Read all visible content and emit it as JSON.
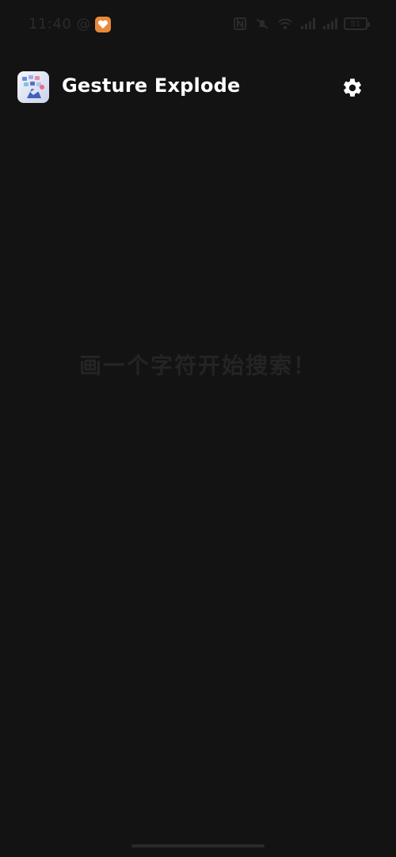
{
  "status_bar": {
    "time": "11:40",
    "at_symbol": "@",
    "battery": "81",
    "icons": [
      "notification-app-icon",
      "nfc-icon",
      "mute-icon",
      "wifi-icon",
      "signal-icon",
      "signal-icon",
      "battery-icon"
    ]
  },
  "app_bar": {
    "title": "Gesture Explode",
    "settings_icon": "gear-icon"
  },
  "main": {
    "hint": "画一个字符开始搜索！"
  },
  "colors": {
    "background": "#131313",
    "title": "#ffffff",
    "hint": "#242424",
    "status_text": "#2b2b2b",
    "accent_orange": "#e98a3b"
  }
}
